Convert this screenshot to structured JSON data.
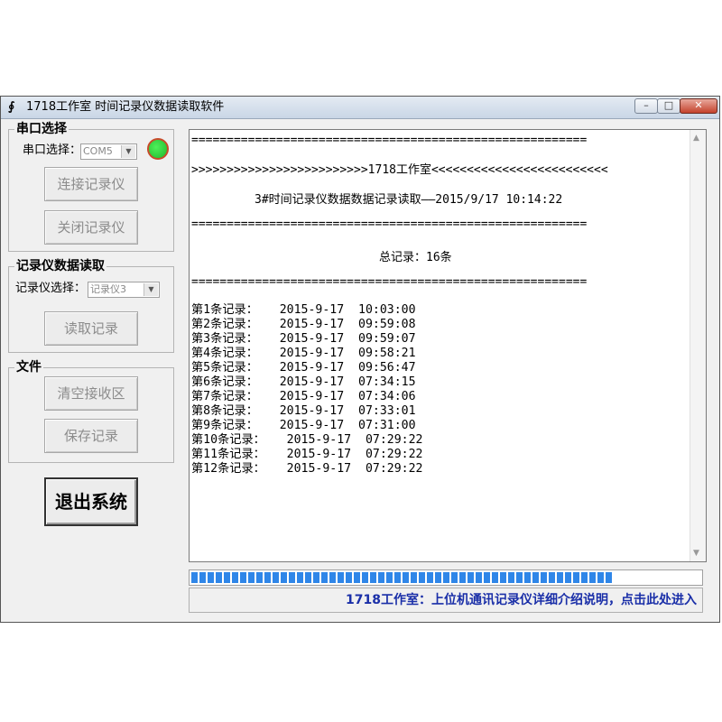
{
  "window": {
    "title": "1718工作室 时间记录仪数据读取软件",
    "controls": {
      "minimize": "–",
      "maximize": "□",
      "close": "✕"
    }
  },
  "serial_group": {
    "title": "串口选择",
    "port_label": "串口选择：",
    "port_value": "COM5",
    "status_color": "#1fb82b",
    "connect_button": "连接记录仪",
    "close_button": "关闭记录仪"
  },
  "read_group": {
    "title": "记录仪数据读取",
    "device_label": "记录仪选择：",
    "device_value": "记录仪3",
    "read_button": "读取记录"
  },
  "file_group": {
    "title": "文件",
    "clear_button": "清空接收区",
    "save_button": "保存记录"
  },
  "exit_button": "退出系统",
  "output": {
    "separator": "========================================================",
    "banner": ">>>>>>>>>>>>>>>>>>>>>>>>>1718工作室<<<<<<<<<<<<<<<<<<<<<<<<<",
    "header": "3#时间记录仪数据数据记录读取——2015/9/17 10:14:22",
    "total": "总记录：16条",
    "records": [
      "第1条记录：   2015-9-17  10:03:00",
      "第2条记录：   2015-9-17  09:59:08",
      "第3条记录：   2015-9-17  09:59:07",
      "第4条记录：   2015-9-17  09:58:21",
      "第5条记录：   2015-9-17  09:56:47",
      "第6条记录：   2015-9-17  07:34:15",
      "第7条记录：   2015-9-17  07:34:06",
      "第8条记录：   2015-9-17  07:33:01",
      "第9条记录：   2015-9-17  07:31:00",
      "第10条记录：   2015-9-17  07:29:22",
      "第11条记录：   2015-9-17  07:29:22",
      "第12条记录：   2015-9-17  07:29:22"
    ]
  },
  "progress": {
    "fraction": 0.83,
    "color": "#2f86e8"
  },
  "link_text": "1718工作室：上位机通讯记录仪详细介绍说明，点击此处进入"
}
